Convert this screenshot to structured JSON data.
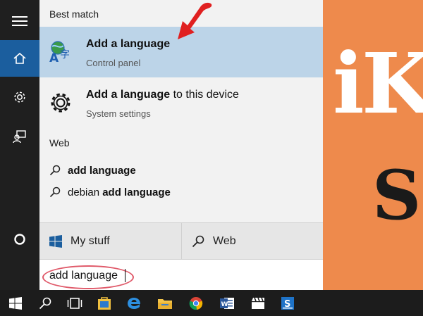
{
  "desktop": {
    "bg_letters": "iK",
    "bg_glyph": "S"
  },
  "rail": {
    "items": [
      {
        "icon": "hamburger-icon",
        "active": false
      },
      {
        "icon": "home-icon",
        "active": true
      },
      {
        "icon": "gear-icon",
        "active": false
      },
      {
        "icon": "feedback-icon",
        "active": false
      },
      {
        "icon": "cortana-circle-icon",
        "active": false
      }
    ]
  },
  "panel": {
    "best_match_label": "Best match",
    "best_match": {
      "title": "Add a language",
      "subtitle": "Control panel",
      "icon": "language-icon"
    },
    "second_result": {
      "title_bold": "Add a language",
      "title_rest": " to this device",
      "subtitle": "System settings",
      "icon": "gear-icon"
    },
    "web_label": "Web",
    "web_results": [
      {
        "prefix": "",
        "bold": "add language"
      },
      {
        "prefix": "debian ",
        "bold": "add language"
      }
    ],
    "scopes": {
      "my_stuff": "My stuff",
      "web": "Web"
    },
    "search": {
      "value": "add language"
    }
  },
  "annotation": {
    "color": "#e02020",
    "highlight_color": "#e05a6a"
  },
  "colors": {
    "accent": "#1b5e9e",
    "desktop": "#ee8a4c",
    "selection": "#bcd4e8"
  },
  "taskbar": {
    "items": [
      "start-icon",
      "search-icon",
      "task-view-icon",
      "store-icon",
      "edge-icon",
      "file-explorer-icon",
      "chrome-icon",
      "word-icon",
      "media-icon",
      "app-s-icon"
    ]
  }
}
